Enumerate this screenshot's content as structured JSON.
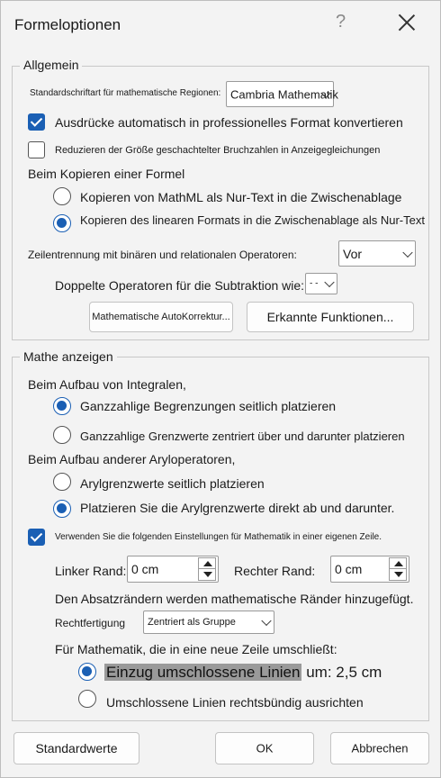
{
  "dialog": {
    "title": "Formeloptionen",
    "help_glyph": "?"
  },
  "general": {
    "legend": "Allgemein",
    "default_font_label": "Standardschriftart für mathematische Regionen:",
    "default_font_value": "Cambria Mathematik",
    "auto_format_label": "Ausdrücke automatisch in professionelles Format konvertieren",
    "auto_format_checked": true,
    "reduce_fractions_label": "Reduzieren der Größe geschachtelter Bruchzahlen in Anzeigegleichungen",
    "reduce_fractions_checked": false,
    "copy_heading": "Beim Kopieren einer Formel",
    "copy_mathml_label": "Kopieren von MathML als Nur-Text in die Zwischenablage",
    "copy_linear_label": "Kopieren des linearen Formats in die Zwischenablage als Nur-Text",
    "copy_selected": "linear",
    "line_break_label": "Zeilentrennung mit binären und relationalen Operatoren:",
    "line_break_value": "Vor",
    "duplicate_operators_label": "Doppelte Operatoren für die Subtraktion wie:",
    "duplicate_operators_value": "- -",
    "autocorrect_button": "Mathematische AutoKorrektur...",
    "recognized_functions_button": "Erkannte Funktionen..."
  },
  "display": {
    "legend": "Mathe anzeigen",
    "integrals_heading": "Beim Aufbau von Integralen,",
    "integral_side_label": "Ganzzahlige Begrenzungen seitlich platzieren",
    "integral_center_label": "Ganzzahlige Grenzwerte zentriert über und darunter platzieren",
    "integral_selected": "side",
    "nary_heading": "Beim Aufbau anderer Aryloperatoren,",
    "nary_side_label": "Arylgrenzwerte seitlich platzieren",
    "nary_direct_label": "Platzieren Sie die Arylgrenzwerte direkt ab und darunter.",
    "nary_selected": "direct",
    "own_line_label": "Verwenden Sie die folgenden Einstellungen für Mathematik in einer eigenen Zeile.",
    "own_line_checked": true,
    "left_margin_label": "Linker Rand:",
    "left_margin_value": "0 cm",
    "right_margin_label": "Rechter Rand:",
    "right_margin_value": "0 cm",
    "margins_note": "Den Absatzrändern werden mathematische Ränder hinzugefügt.",
    "justification_label": "Rechtfertigung",
    "justification_value": "Zentriert als Gruppe",
    "wrap_heading": "Für Mathematik, die in eine neue Zeile umschließt:",
    "wrap_indent_label": "Einzug umschlossene Linien",
    "wrap_indent_suffix": "um: 2,5 cm",
    "wrap_right_label": "Umschlossene Linien rechtsbündig ausrichten",
    "wrap_selected": "indent"
  },
  "footer": {
    "defaults_button": "Standardwerte",
    "ok_button": "OK",
    "cancel_button": "Abbrechen"
  }
}
